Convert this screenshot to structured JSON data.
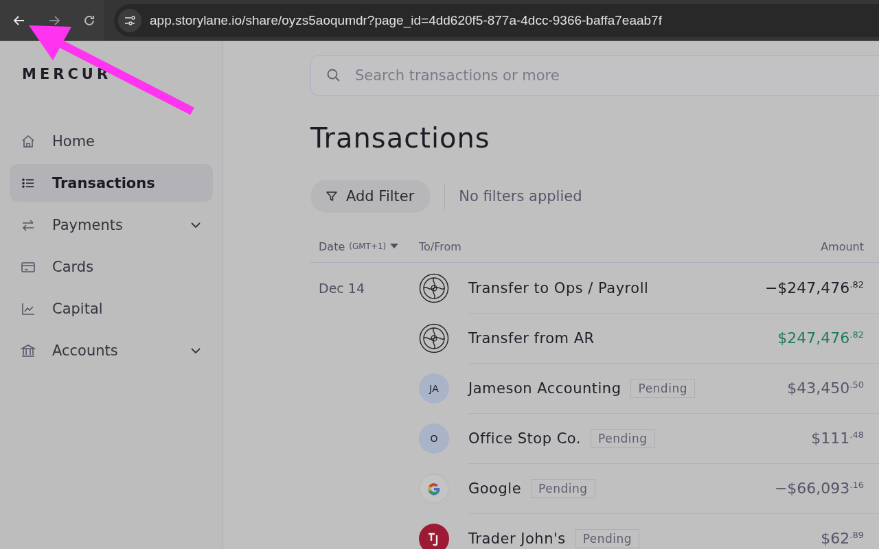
{
  "browser": {
    "url": "app.storylane.io/share/oyzs5aoqumdr?page_id=4dd620f5-877a-4dcc-9366-baffa7eaab7f"
  },
  "logo": "MERCUR",
  "sidebar": {
    "items": [
      {
        "label": "Home",
        "kind": "home",
        "selected": false,
        "expandable": false
      },
      {
        "label": "Transactions",
        "kind": "list",
        "selected": true,
        "expandable": false
      },
      {
        "label": "Payments",
        "kind": "swap",
        "selected": false,
        "expandable": true
      },
      {
        "label": "Cards",
        "kind": "card",
        "selected": false,
        "expandable": false
      },
      {
        "label": "Capital",
        "kind": "chart",
        "selected": false,
        "expandable": false
      },
      {
        "label": "Accounts",
        "kind": "bank",
        "selected": false,
        "expandable": true
      }
    ]
  },
  "search": {
    "placeholder": "Search transactions or more"
  },
  "title": "Transactions",
  "filter": {
    "button": "Add Filter",
    "status": "No filters applied"
  },
  "table": {
    "columns": {
      "date": "Date",
      "date_note": "(GMT+1)",
      "party": "To/From",
      "amount": "Amount"
    },
    "rows": [
      {
        "date": "Dec 14",
        "avatar": {
          "kind": "logo"
        },
        "name": "Transfer to Ops / Payroll",
        "amount": "−$247,476$^{.82}$",
        "incoming": false
      },
      {
        "avatar": {
          "kind": "logo"
        },
        "name": "Transfer from AR",
        "amount": "$247,476$^{.82}$",
        "incoming": true
      },
      {
        "avatar": {
          "kind": "initials",
          "text": "JA"
        },
        "name": "Jameson Accounting",
        "badge": "Pending",
        "amount": "$43,450$^{.50}$",
        "incoming": false
      },
      {
        "avatar": {
          "kind": "initials",
          "text": "O"
        },
        "name": "Office Stop Co.",
        "badge": "Pending",
        "amount": "$111$^{.48}$",
        "incoming": false
      },
      {
        "avatar": {
          "kind": "google"
        },
        "name": "Google",
        "badge": "Pending",
        "amount": "−$66,093$^{.16}$",
        "incoming": false
      },
      {
        "avatar": {
          "kind": "monogram"
        },
        "name": "Trader John's",
        "badge": "Pending",
        "amount": "$62$^{.89}$",
        "incoming": false
      }
    ]
  }
}
